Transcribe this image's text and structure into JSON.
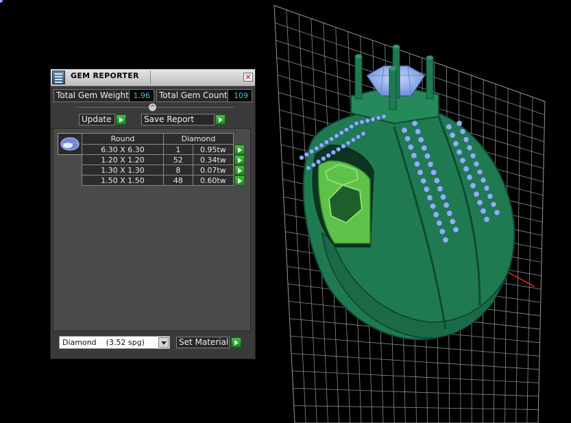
{
  "panel": {
    "title": "GEM REPORTER",
    "close_symbol": "✕",
    "total_gem_weight_label": "Total Gem Weight",
    "total_gem_weight_value": "1.96",
    "total_gem_count_label": "Total Gem Count",
    "total_gem_count_value": "109",
    "collapse_symbol": "^",
    "update_label": "Update",
    "save_report_label": "Save Report",
    "table": {
      "header_shape": "Round",
      "header_material": "Diamond",
      "rows": [
        {
          "size": "6.30 X 6.30",
          "count": "1",
          "weight": "0.95tw"
        },
        {
          "size": "1.20 X 1.20",
          "count": "52",
          "weight": "0.34tw"
        },
        {
          "size": "1.30 X 1.30",
          "count": "8",
          "weight": "0.07tw"
        },
        {
          "size": "1.50 X 1.50",
          "count": "48",
          "weight": "0.60tw"
        }
      ]
    },
    "material_select_value": "Diamond    (3.52 spg)",
    "set_material_label": "Set Material"
  },
  "colors": {
    "ring_green": "#1d6f4a",
    "gem_blue": "#8fb0f0",
    "value_cyan": "#39c8e0",
    "arrow_green": "#2fa82f"
  },
  "icons": {
    "title": "gem-reporter-icon",
    "close": "close-icon",
    "arrow": "play-arrow-icon",
    "gem": "round-gem-icon",
    "dropdown": "chevron-down-icon"
  }
}
